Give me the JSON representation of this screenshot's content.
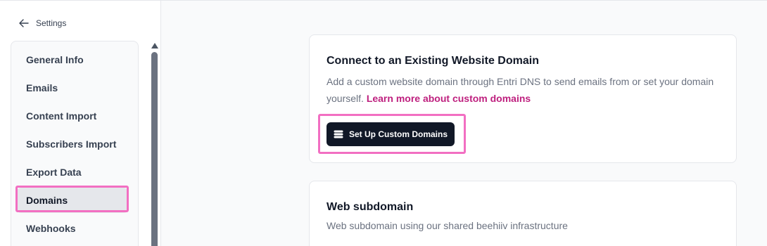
{
  "header": {
    "back_label": "Settings",
    "back_icon": "arrow-left-icon"
  },
  "sidebar": {
    "items": [
      {
        "label": "General Info",
        "active": false
      },
      {
        "label": "Emails",
        "active": false
      },
      {
        "label": "Content Import",
        "active": false
      },
      {
        "label": "Subscribers Import",
        "active": false
      },
      {
        "label": "Export Data",
        "active": false
      },
      {
        "label": "Domains",
        "active": true
      },
      {
        "label": "Webhooks",
        "active": false
      }
    ]
  },
  "main": {
    "custom_domain_card": {
      "title": "Connect to an Existing Website Domain",
      "description": "Add a custom website domain through Entri DNS to send emails from or set your domain yourself.",
      "learn_more_label": "Learn more about custom domains",
      "button_label": "Set Up Custom Domains",
      "button_icon": "server-stack-icon"
    },
    "subdomain_card": {
      "title": "Web subdomain",
      "description": "Web subdomain using our shared beehiiv infrastructure"
    }
  },
  "colors": {
    "accent_link": "#be1f7e",
    "highlight": "#f26fc2",
    "primary_button": "#111827"
  }
}
